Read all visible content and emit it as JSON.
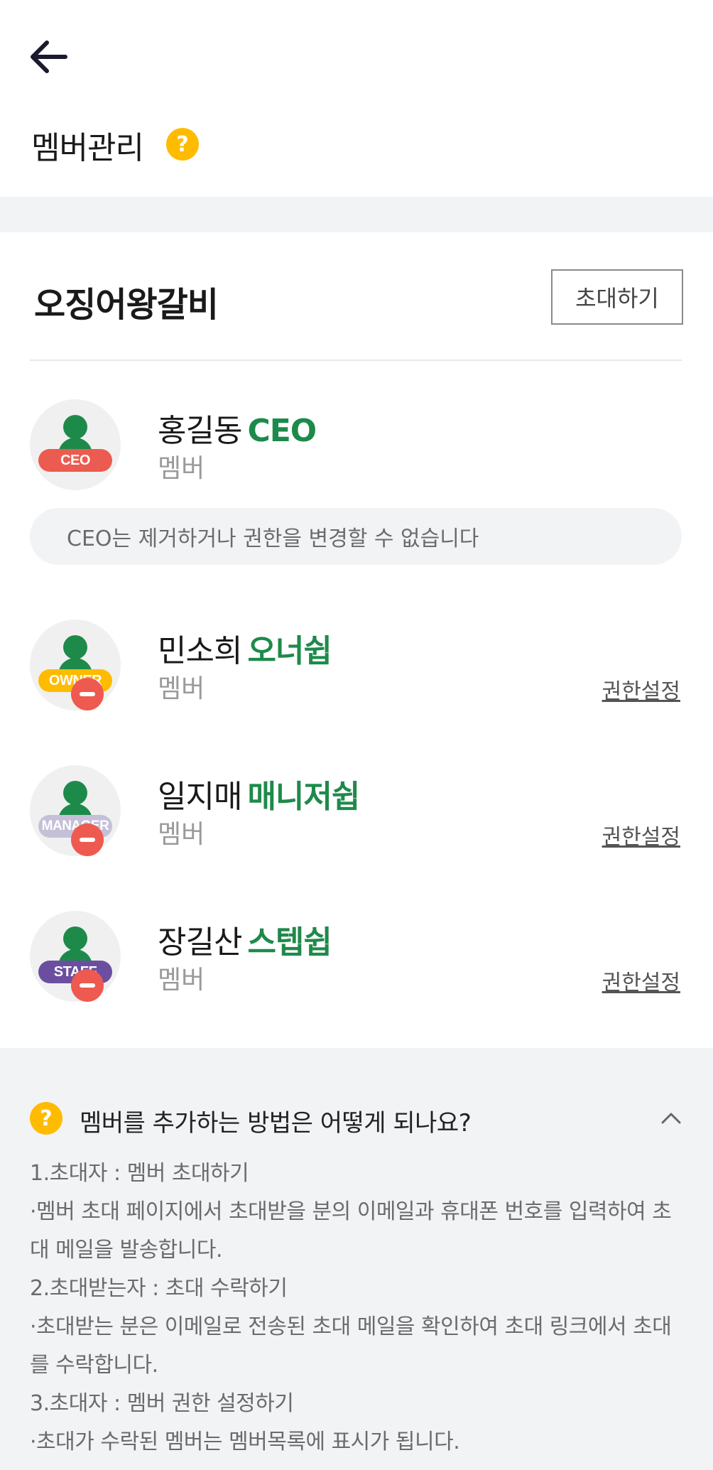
{
  "header": {
    "title": "멤버관리",
    "help_badge": "?"
  },
  "store": {
    "name": "오징어왕갈비",
    "invite_label": "초대하기"
  },
  "members": [
    {
      "name": "홍길동",
      "role": "CEO",
      "tag": "CEO",
      "tag_color": "#ec5b4f",
      "sub": "멤버",
      "removable": false,
      "perm_label": ""
    },
    {
      "name": "민소희",
      "role": "오너쉽",
      "tag": "OWNER",
      "tag_color": "#ffbb00",
      "sub": "멤버",
      "removable": true,
      "perm_label": "권한설정"
    },
    {
      "name": "일지매",
      "role": "매니저쉽",
      "tag": "MANAGER",
      "tag_color": "#c5c0d8",
      "sub": "멤버",
      "removable": true,
      "perm_label": "권한설정"
    },
    {
      "name": "장길산",
      "role": "스텝쉽",
      "tag": "STAFF",
      "tag_color": "#6b4ea0",
      "sub": "멤버",
      "removable": true,
      "perm_label": "권한설정"
    }
  ],
  "ceo_notice": "CEO는 제거하거나 권한을 변경할 수 없습니다",
  "faq": {
    "icon": "?",
    "question": "멤버를 추가하는 방법은 어떻게 되나요?",
    "lines": [
      "1.초대자 : 멤버 초대하기",
      "·멤버 초대 페이지에서 초대받을 분의 이메일과 휴대폰 번호를 입력하여 초대 메일을 발송합니다.",
      "2.초대받는자 : 초대 수락하기",
      "·초대받는 분은 이메일로 전송된 초대 메일을 확인하여 초대 링크에서 초대를 수락합니다.",
      "3.초대자 : 멤버 권한 설정하기",
      "·초대가 수락된 멤버는 멤버목록에 표시가 됩니다."
    ]
  },
  "colors": {
    "accent_green": "#1e8a4a",
    "help_yellow": "#ffbb00",
    "remove_red": "#ee5a4f"
  }
}
